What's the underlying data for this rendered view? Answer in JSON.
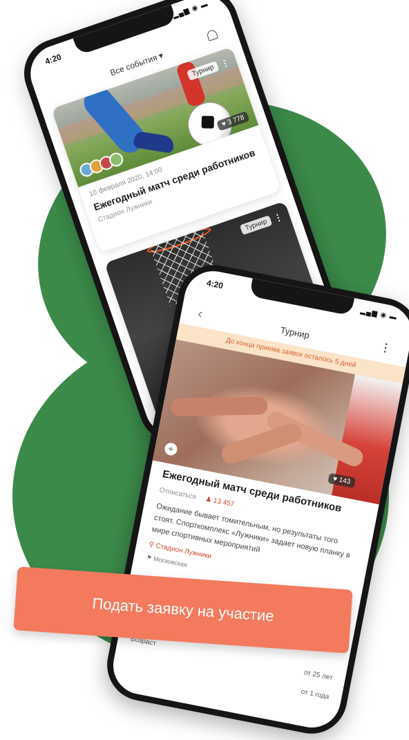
{
  "status_time": "4:20",
  "events_screen": {
    "filter_label": "Все события",
    "events": [
      {
        "tag": "Турнир",
        "likes": "3 778",
        "date": "10 февраля 2020, 14:00",
        "title": "Ежегодный матч среди работников",
        "venue": "Стадион Лужники"
      },
      {
        "tag": "Турнир"
      }
    ]
  },
  "detail_screen": {
    "header": "Турнир",
    "banner": "До конца приема заявок осталось 5 дней",
    "likes": "143",
    "title": "Ежегодный матч среди работников",
    "unsubscribe": "Отписаться",
    "participants": "13 457",
    "description": "Ожидание бывает томительным, но результаты того стоят. Спорткомплекс «Лужники» задает новую планку в мире спортивных мероприятий",
    "location": "Стадион Лужники",
    "region": "Московская",
    "age_label": "Возраст",
    "age_value": "от 25 лет",
    "experience_value": "от 1 года"
  },
  "cta_label": "Подать заявку на участие",
  "colors": {
    "accent": "#f47a5e",
    "brand_green": "#3c8a4a",
    "banner_bg": "#fbe3c8",
    "red_text": "#d6422f"
  },
  "icons": {
    "bell": "bell-icon",
    "back": "chevron-left-icon",
    "heart": "heart-icon",
    "location": "location-pin-icon",
    "flag": "flag-icon",
    "person": "person-icon",
    "more": "more-vertical-icon",
    "filter": "chevron-down-icon"
  }
}
